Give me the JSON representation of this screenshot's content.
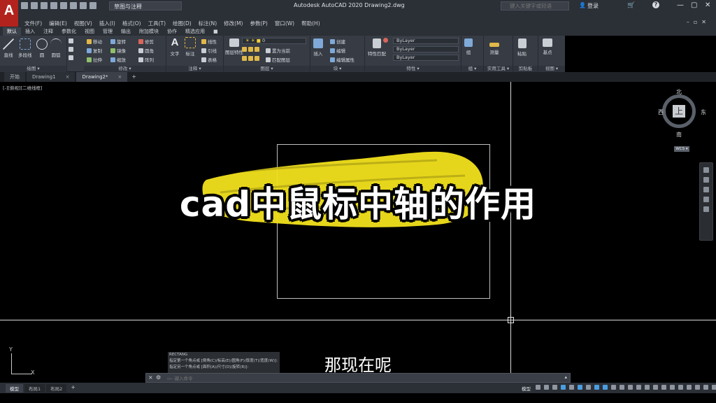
{
  "app": {
    "logo_letter": "A",
    "window_title": "Autodesk AutoCAD 2020    Drawing2.dwg",
    "workspace": "草图与注释",
    "search_placeholder": "键入关键字或短语",
    "login": "登录",
    "user_icon": "user-icon",
    "cart_icon": "cart-icon",
    "help_label": "?"
  },
  "menubar": {
    "items": [
      "文件(F)",
      "编辑(E)",
      "视图(V)",
      "插入(I)",
      "格式(O)",
      "工具(T)",
      "绘图(D)",
      "标注(N)",
      "修改(M)",
      "参数(P)",
      "窗口(W)",
      "帮助(H)"
    ]
  },
  "ribbon_tabs": {
    "items": [
      "默认",
      "插入",
      "注释",
      "参数化",
      "视图",
      "管理",
      "输出",
      "附加模块",
      "协作",
      "精选应用"
    ],
    "active_index": 0,
    "minimize_icon": "■"
  },
  "ribbon": {
    "panels": {
      "draw": "绘图 ▾",
      "modify": "修改 ▾",
      "annotation": "注释 ▾",
      "layers": "图层 ▾",
      "block": "块 ▾",
      "properties": "特性 ▾",
      "groups": "组 ▾",
      "utilities": "实用工具 ▾",
      "clipboard": "剪贴板",
      "view": "视图 ▾"
    },
    "draw_tools": [
      "直线",
      "多段线",
      "圆",
      "圆弧"
    ],
    "modify_tools": [
      "移动",
      "旋转",
      "修剪",
      "复制",
      "镜像",
      "圆角",
      "拉伸",
      "缩放",
      "阵列"
    ],
    "annotation_tools": [
      "文字",
      "标注",
      "线性",
      "引线",
      "表格"
    ],
    "layer_tools": [
      "图层特性",
      "置为当前",
      "匹配图层"
    ],
    "layer_value": "0",
    "block_tools": [
      "插入",
      "创建",
      "编辑",
      "编辑属性"
    ],
    "property_tools": [
      "特性匹配"
    ],
    "bylayer": [
      "ByLayer",
      "ByLayer",
      "ByLayer"
    ],
    "group_tool": "组",
    "utility_tool": "测量",
    "clipboard_tool": "粘贴",
    "view_tool": "基点"
  },
  "file_tabs": {
    "items": [
      "开始",
      "Drawing1",
      "Drawing2*"
    ],
    "active_index": 2,
    "close_glyph": "×",
    "add_glyph": "+"
  },
  "canvas": {
    "viewport_label": "[-][俯视][二维线框]"
  },
  "viewcube": {
    "north": "北",
    "south": "南",
    "east": "东",
    "west": "西",
    "face": "上",
    "wcs": "WCS ▾"
  },
  "ucs": {
    "x": "X",
    "y": "Y"
  },
  "command_history": [
    "RECTANG",
    "指定第一个角点或 [倒角(C)/标高(E)/圆角(F)/厚度(T)/宽度(W)]:",
    "指定另一个角点或 [面积(A)/尺寸(D)/旋转(R)]:"
  ],
  "overlay": {
    "title": "cad中鼠标中轴的作用",
    "subtitle": "那现在呢",
    "brush_color": "#f2e11c"
  },
  "command_line": {
    "close_glyph": "×",
    "wrench_glyph": "🔧",
    "placeholder": "▭- 键入命令",
    "arrow": "▴"
  },
  "statusbar": {
    "layout_tabs": [
      "模型",
      "布局1",
      "布局2"
    ],
    "active_index": 0,
    "add_glyph": "+",
    "model_label": "模型"
  }
}
